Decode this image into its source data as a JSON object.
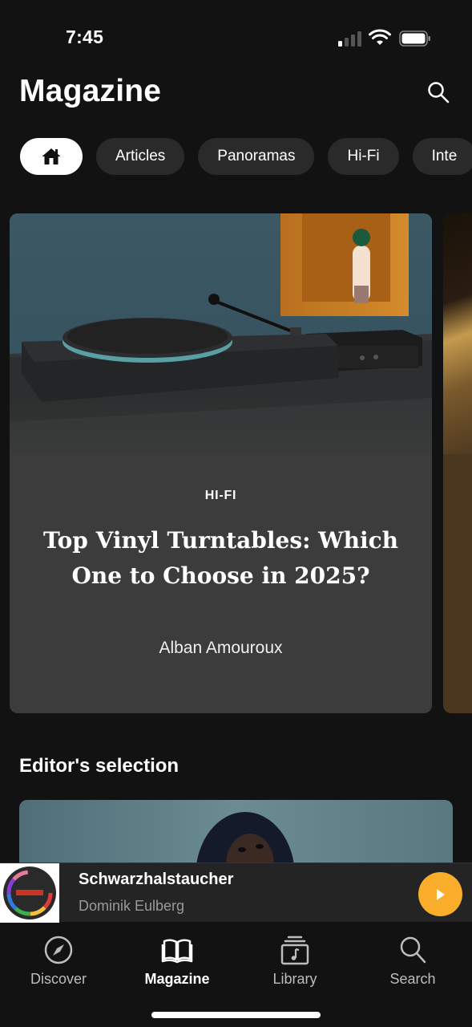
{
  "status_bar": {
    "time": "7:45",
    "signal_icon": "cellular-signal-icon",
    "wifi_icon": "wifi-icon",
    "battery_icon": "battery-icon"
  },
  "header": {
    "title": "Magazine",
    "search_icon": "search-icon"
  },
  "chips": [
    {
      "label": "",
      "icon": "home-icon",
      "selected": true
    },
    {
      "label": "Articles",
      "selected": false
    },
    {
      "label": "Panoramas",
      "selected": false
    },
    {
      "label": "Hi-Fi",
      "selected": false
    },
    {
      "label": "Inte",
      "selected": false
    }
  ],
  "hero": {
    "category": "HI-FI",
    "title": "Top Vinyl Turntables: Which One to Choose in 2025?",
    "author": "Alban Amouroux",
    "image": "turntable-photo",
    "accent_color": "#3b3c3b"
  },
  "hero_next": {
    "image": "partial-next-article-photo",
    "accent_color": "#4b3620"
  },
  "editors_selection": {
    "title": "Editor's selection",
    "image": "portrait-photo"
  },
  "mini_player": {
    "track_title": "Schwarzhalstaucher",
    "artist": "Dominik Eulberg",
    "artwork": "album-artwork",
    "play_icon": "play-icon",
    "accent_color": "#f9ad2a"
  },
  "bottom_nav": [
    {
      "label": "Discover",
      "icon": "compass-icon",
      "active": false
    },
    {
      "label": "Magazine",
      "icon": "open-book-icon",
      "active": true
    },
    {
      "label": "Library",
      "icon": "music-library-icon",
      "active": false
    },
    {
      "label": "Search",
      "icon": "search-icon",
      "active": false
    }
  ]
}
